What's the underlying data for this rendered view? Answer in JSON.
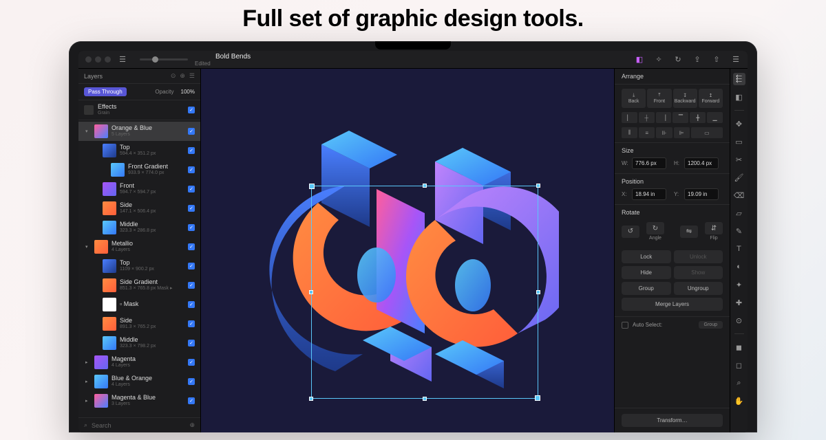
{
  "headline": "Full set of graphic design tools.",
  "titlebar": {
    "doc_title": "Bold Bends",
    "doc_status": "Edited"
  },
  "left": {
    "panel_title": "Layers",
    "blend_mode": "Pass Through",
    "opacity_label": "Opacity",
    "opacity_value": "100%",
    "effects_label": "Effects",
    "effects_sub": "Grain",
    "search_placeholder": "Search",
    "groups": [
      {
        "name": "Orange & Blue",
        "sub": "5 Layers",
        "thumb": "th-gradient",
        "children": [
          {
            "name": "Top",
            "sub": "594.4 × 351.2 px",
            "thumb": "th-blue"
          },
          {
            "name": "Front Gradient",
            "sub": "933.9 × 774.0 px",
            "thumb": "th-cyan",
            "indent": true
          },
          {
            "name": "Front",
            "sub": "594.7 × 594.7 px",
            "thumb": "th-purple"
          },
          {
            "name": "Side",
            "sub": "147.1 × 506.4 px",
            "thumb": "th-orange"
          },
          {
            "name": "Middle",
            "sub": "323.3 × 286.8 px",
            "thumb": "th-cyan"
          }
        ]
      },
      {
        "name": "Metallio",
        "sub": "4 Layers",
        "thumb": "th-orange",
        "children": [
          {
            "name": "Top",
            "sub": "1109 × 900.2 px",
            "thumb": "th-blue"
          },
          {
            "name": "Side Gradient",
            "sub": "851.3 × 765.8 px  Mask ▸",
            "thumb": "th-orange"
          },
          {
            "name": "Mask",
            "sub": "",
            "thumb": "th-white",
            "mask": true
          },
          {
            "name": "Side",
            "sub": "891.3 × 765.2 px",
            "thumb": "th-orange"
          },
          {
            "name": "Middle",
            "sub": "323.3 × 798.2 px",
            "thumb": "th-cyan"
          }
        ]
      },
      {
        "name": "Magenta",
        "sub": "4 Layers",
        "thumb": "th-purple",
        "children": []
      },
      {
        "name": "Blue & Orange",
        "sub": "4 Layers",
        "thumb": "th-cyan",
        "children": []
      },
      {
        "name": "Magenta & Blue",
        "sub": "3 Layers",
        "thumb": "th-gradient",
        "children": []
      }
    ]
  },
  "right": {
    "panel_title": "Arrange",
    "order": [
      "Back",
      "Front",
      "Backward",
      "Forward"
    ],
    "size_label": "Size",
    "width": "776.6 px",
    "height": "1200.4 px",
    "pos_label": "Position",
    "x": "18.94 in",
    "y": "19.09 in",
    "rotate_label": "Rotate",
    "angle_label": "Angle",
    "flip_label": "Flip",
    "lock": "Lock",
    "unlock": "Unlock",
    "hide": "Hide",
    "show": "Show",
    "group": "Group",
    "ungroup": "Ungroup",
    "merge": "Merge Layers",
    "auto_select": "Auto Select:",
    "auto_mode": "Group",
    "transform": "Transform…"
  },
  "w_pre": "W:",
  "h_pre": "H:",
  "x_pre": "X:",
  "y_pre": "Y:"
}
